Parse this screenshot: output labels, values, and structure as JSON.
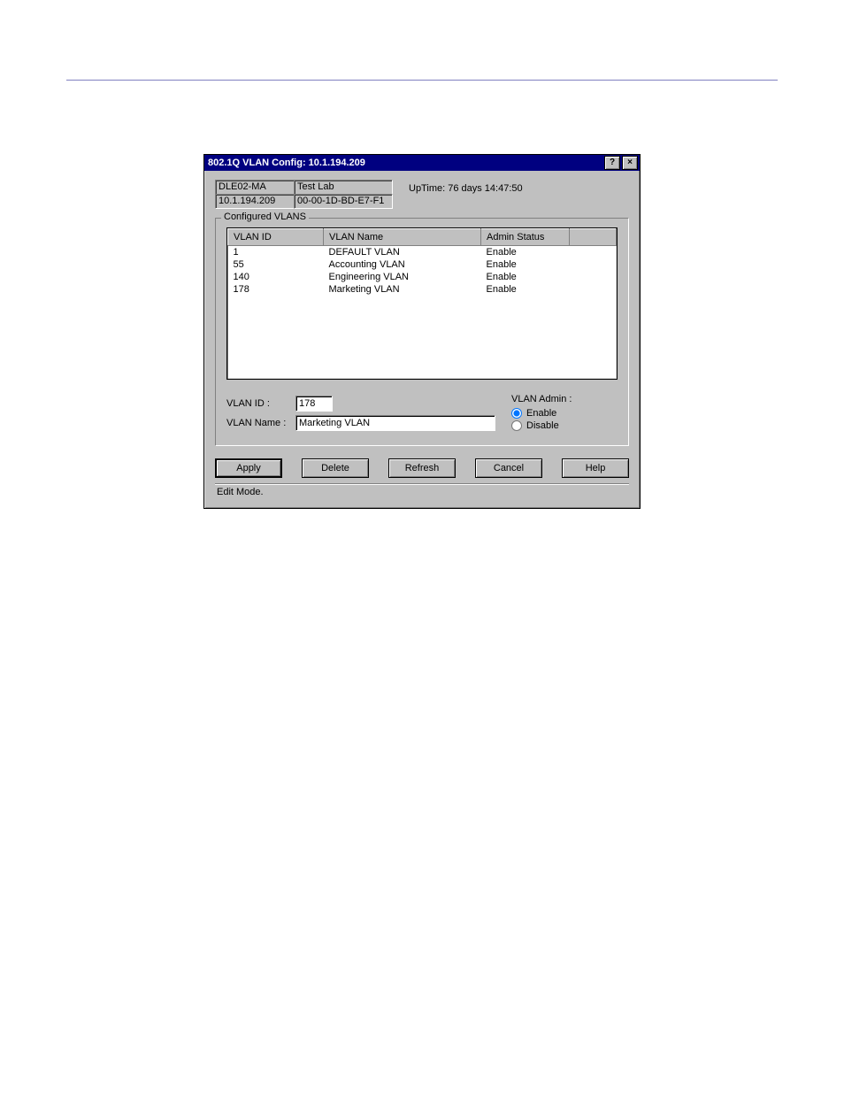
{
  "titlebar": {
    "title": "802.1Q VLAN Config: 10.1.194.209",
    "help_btn": "?",
    "close_btn": "×"
  },
  "device": {
    "name": "DLE02-MA",
    "ip": "10.1.194.209",
    "location": "Test Lab",
    "mac": "00-00-1D-BD-E7-F1",
    "uptime_label": "UpTime: 76 days 14:47:50"
  },
  "group": {
    "label": "Configured VLANS",
    "headers": {
      "id": "VLAN ID",
      "name": "VLAN Name",
      "status": "Admin Status"
    },
    "rows": [
      {
        "id": "1",
        "name": "DEFAULT VLAN",
        "status": "Enable"
      },
      {
        "id": "55",
        "name": "Accounting VLAN",
        "status": "Enable"
      },
      {
        "id": "140",
        "name": "Engineering VLAN",
        "status": "Enable"
      },
      {
        "id": "178",
        "name": "Marketing VLAN",
        "status": "Enable"
      }
    ]
  },
  "form": {
    "vlan_id_label": "VLAN ID :",
    "vlan_id_value": "178",
    "vlan_name_label": "VLAN Name :",
    "vlan_name_value": "Marketing VLAN",
    "admin_label": "VLAN Admin :",
    "enable_label": "Enable",
    "disable_label": "Disable"
  },
  "buttons": {
    "apply": "Apply",
    "delete": "Delete",
    "refresh": "Refresh",
    "cancel": "Cancel",
    "help": "Help"
  },
  "status": "Edit Mode."
}
